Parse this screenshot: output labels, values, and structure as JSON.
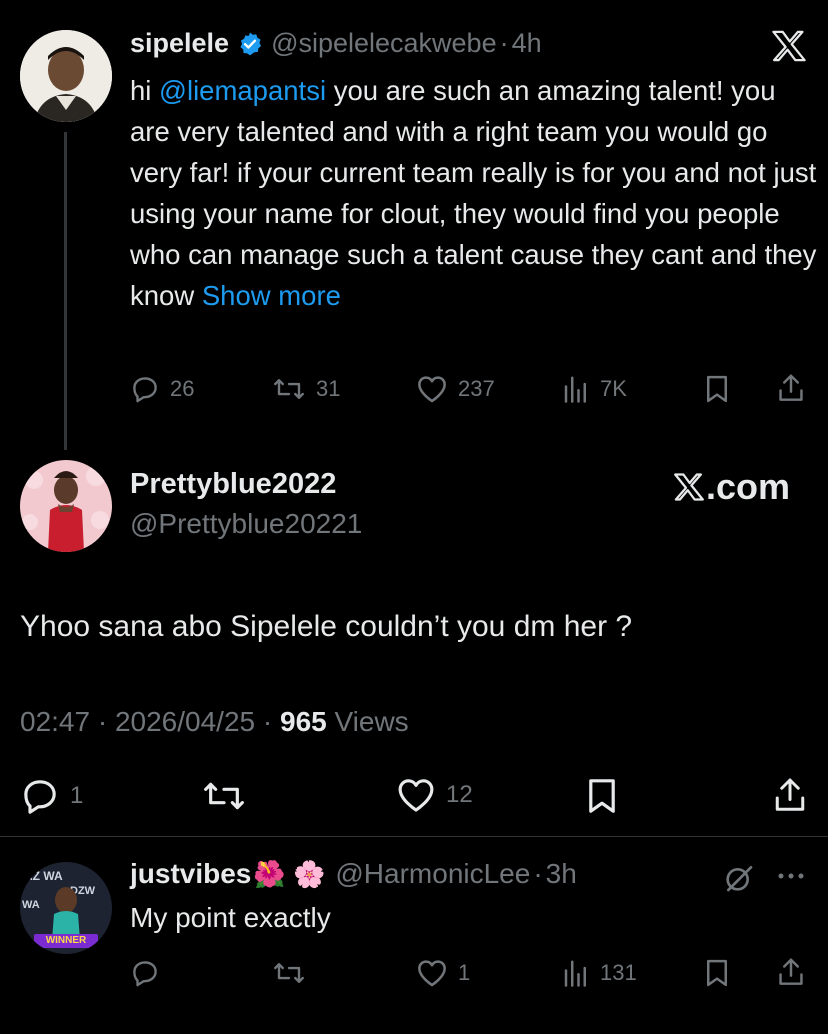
{
  "tweet1": {
    "display_name": "sipelele",
    "handle": "@sipelelecakwebe",
    "separator": "·",
    "time": "4h",
    "text_prefix": "hi ",
    "mention": "@liemapantsi",
    "text_body": " you are such an amazing talent! you are very talented and with a right team you would go very far! if your current team really is for you and not just using your name for clout, they would find you people who can manage such a talent cause they cant and they know ",
    "show_more": "Show more",
    "replies": "26",
    "reposts": "31",
    "likes": "237",
    "views": "7K",
    "icons": [
      "verified-badge-icon",
      "x-logo-icon",
      "reply-icon",
      "repost-icon",
      "like-icon",
      "views-icon",
      "bookmark-icon",
      "share-icon"
    ]
  },
  "tweet2": {
    "display_name": "Prettyblue2022",
    "handle": "@Prettyblue20221",
    "watermark": ".com",
    "text": "Yhoo sana abo Sipelele couldn’t you dm her ?",
    "time": "02:47",
    "date": "2026/04/25",
    "sep": "·",
    "views_count": "965",
    "views_label": "Views",
    "replies": "1",
    "likes": "12"
  },
  "tweet3": {
    "display_name": "justvibes",
    "emoji": "🌺 🌸",
    "handle": "@HarmonicLee",
    "separator": "·",
    "time": "3h",
    "text": "My point exactly",
    "likes": "1",
    "views": "131",
    "avatar_text": "WINNER"
  },
  "colors": {
    "background": "#000000",
    "text": "#e7e9ea",
    "muted": "#71767b",
    "link": "#1d9bf0"
  }
}
